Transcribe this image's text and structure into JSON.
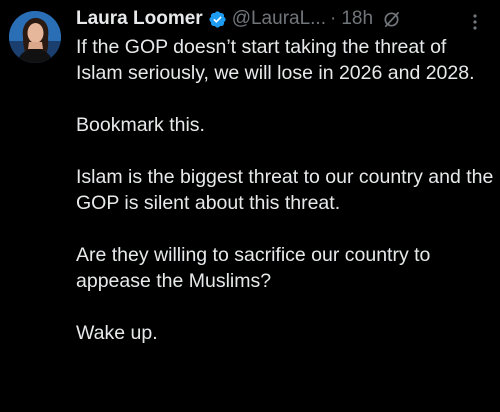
{
  "tweet": {
    "author": {
      "display_name": "Laura Loomer",
      "handle": "@LauraL...",
      "verified": true,
      "avatar_icon": "profile-photo"
    },
    "separator": "·",
    "timestamp": "18h",
    "grok_icon": "grok-icon",
    "more_icon": "more-vertical-icon",
    "paragraphs": [
      "If the GOP doesn’t start taking the threat of Islam seriously, we will lose in 2026 and 2028.",
      "Bookmark this.",
      "Islam is the biggest threat to our country and the GOP is silent about this threat.",
      "Are they willing to sacrifice our country to appease the Muslims?",
      "Wake up."
    ]
  },
  "colors": {
    "background": "#000000",
    "primary_text": "#e7e9ea",
    "secondary_text": "#71767b",
    "verified_blue": "#1d9bf0"
  }
}
